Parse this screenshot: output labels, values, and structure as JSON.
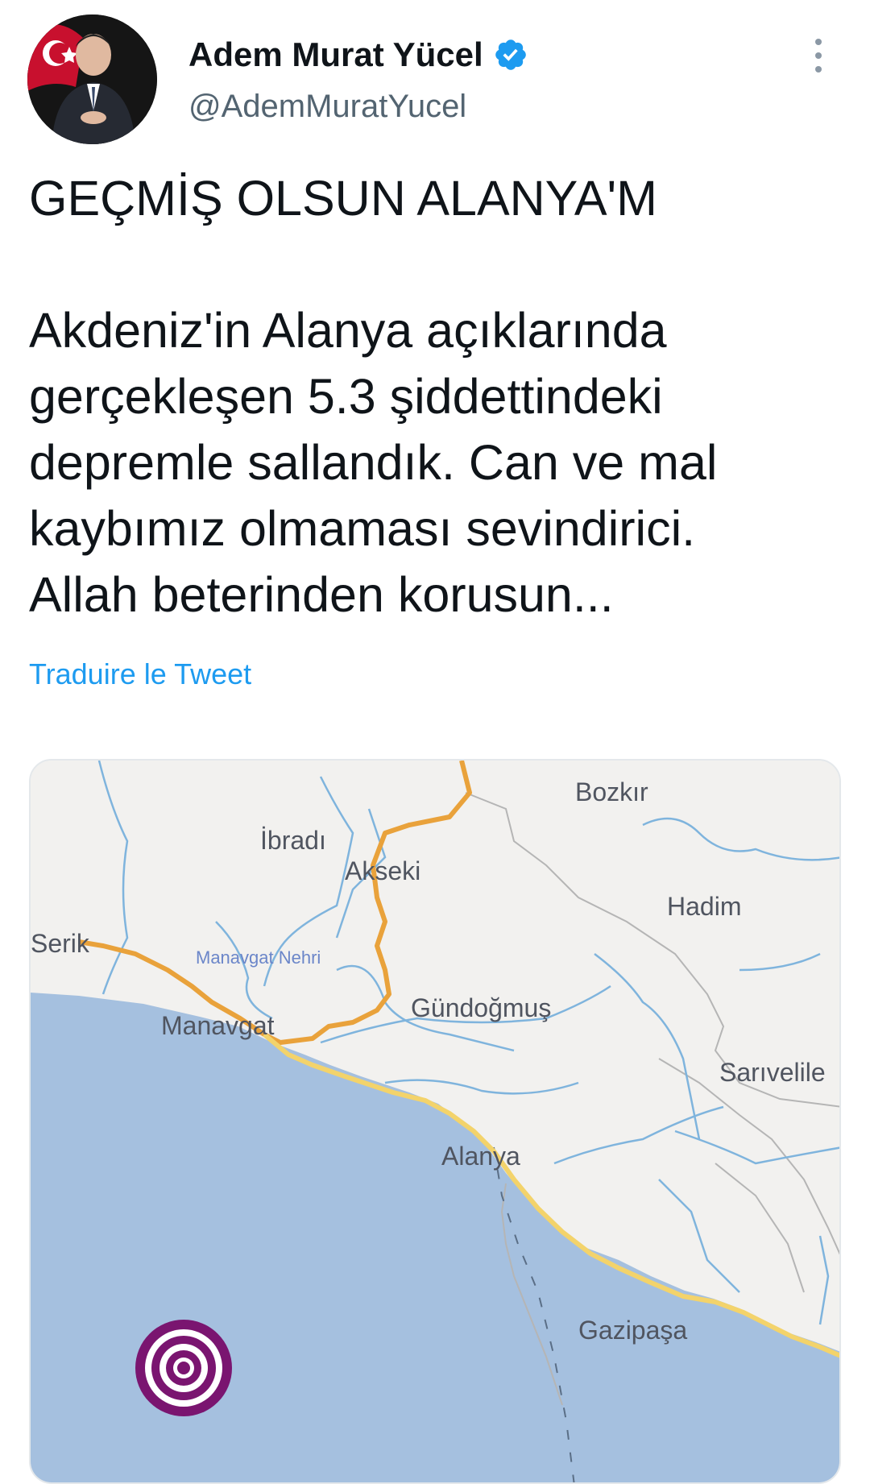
{
  "user": {
    "display_name": "Adem Murat Yücel",
    "handle": "@AdemMuratYucel",
    "verified": true,
    "badge_color": "#1d9bf0"
  },
  "tweet": {
    "text": "GEÇMİŞ OLSUN ALANYA'M\n\nAkdeniz'in Alanya açıklarında\ngerçekleşen 5.3 şiddettindeki\ndepremle sallandık. Can ve mal\nkaybımız olmaması sevindirici.\nAllah beterinden korusun...",
    "translate_label": "Traduire le Tweet"
  },
  "map": {
    "labels": {
      "bozkir": "Bozkır",
      "ibradi": "İbradı",
      "akseki": "Akseki",
      "hadim": "Hadim",
      "serik": "Serik",
      "manavgat_nehri": "Manavgat Nehri",
      "manavgat": "Manavgat",
      "gundogmus": "Gündoğmuş",
      "sarivelile": "Sarıvelile",
      "alanya": "Alanya",
      "gazipasa": "Gazipaşa"
    },
    "colors": {
      "land": "#f2f1ef",
      "sea": "#a5c0df",
      "river": "#7fb4dd",
      "coast_road": "#f3d36b",
      "orange_road": "#e9a23b",
      "border": "#b9b9b9",
      "epicenter": "#7a1570"
    }
  },
  "icons": {
    "verified": "verified-badge-icon",
    "more": "more-options-icon",
    "epicenter": "earthquake-epicenter-icon"
  }
}
